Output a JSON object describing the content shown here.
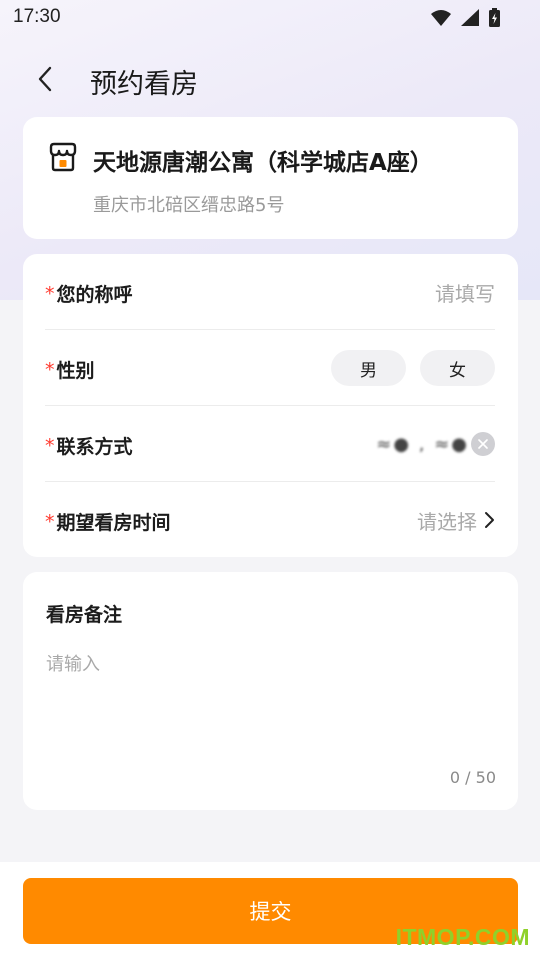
{
  "status_bar": {
    "time": "17:30"
  },
  "nav": {
    "title": "预约看房"
  },
  "store": {
    "name": "天地源唐潮公寓（科学城店A座）",
    "address": "重庆市北碚区缙忠路5号"
  },
  "form": {
    "required_mark": "*",
    "name_row": {
      "label": "您的称呼",
      "placeholder": "请填写"
    },
    "gender_row": {
      "label": "性别",
      "options": [
        "男",
        "女"
      ]
    },
    "contact_row": {
      "label": "联系方式",
      "value": "≈●  ,  ≈●"
    },
    "time_row": {
      "label": "期望看房时间",
      "placeholder": "请选择"
    }
  },
  "note": {
    "title": "看房备注",
    "placeholder": "请输入",
    "counter": "0 / 50"
  },
  "submit": {
    "label": "提交"
  },
  "watermark": "ITMOP.COM",
  "colors": {
    "accent": "#ff8a00",
    "required": "#ff3b30",
    "watermark": "#8fd12a"
  }
}
